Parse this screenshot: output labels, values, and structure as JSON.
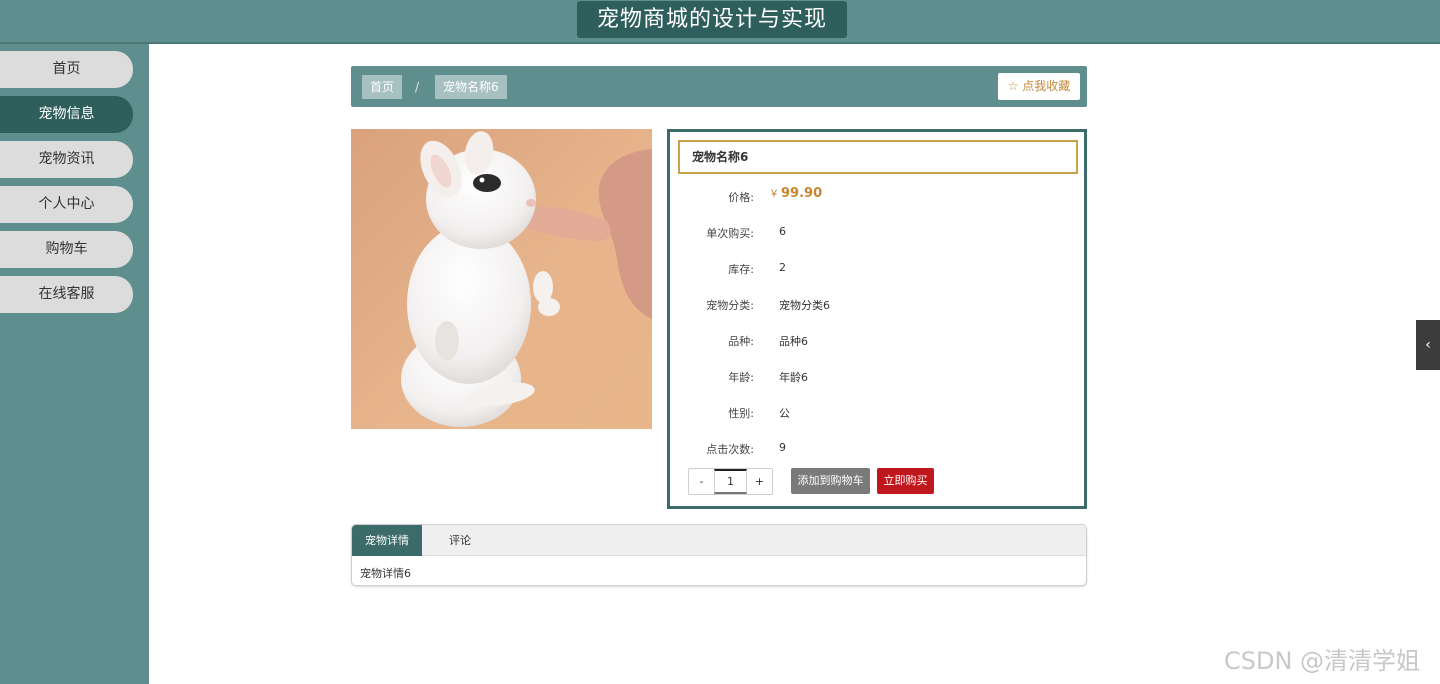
{
  "header": {
    "title": "宠物商城的设计与实现"
  },
  "sidebar": {
    "items": [
      {
        "label": "首页",
        "active": false
      },
      {
        "label": "宠物信息",
        "active": true
      },
      {
        "label": "宠物资讯",
        "active": false
      },
      {
        "label": "个人中心",
        "active": false
      },
      {
        "label": "购物车",
        "active": false
      },
      {
        "label": "在线客服",
        "active": false
      }
    ]
  },
  "breadcrumb": {
    "home": "首页",
    "separator": "/",
    "current": "宠物名称6",
    "favorite_icon": "star-outline-icon",
    "favorite_label": "☆ 点我收藏"
  },
  "product": {
    "image_alt": "white rabbit",
    "name": "宠物名称6",
    "price_symbol": "￥",
    "price": "99.90",
    "rows": [
      {
        "label": "价格:"
      },
      {
        "label": "单次购买:",
        "value": "6"
      },
      {
        "label": "库存:",
        "value": "2"
      },
      {
        "label": "宠物分类:",
        "value": "宠物分类6"
      },
      {
        "label": "品种:",
        "value": "品种6"
      },
      {
        "label": "年龄:",
        "value": "年龄6"
      },
      {
        "label": "性别:",
        "value": "公"
      },
      {
        "label": "点击次数:",
        "value": "9"
      }
    ],
    "quantity": {
      "minus": "-",
      "value": "1",
      "plus": "+"
    },
    "add_to_cart": "添加到购物车",
    "buy_now": "立即购买"
  },
  "tabs": {
    "items": [
      {
        "label": "宠物详情",
        "active": true
      },
      {
        "label": "评论",
        "active": false
      }
    ],
    "content": "宠物详情6"
  },
  "side_toggle": {
    "icon": "chevron-left-icon",
    "glyph": "‹"
  },
  "watermark": "CSDN @清清学姐",
  "colors": {
    "teal": "#5e8f8e",
    "teal_dark": "#2f5f5c",
    "price": "#c9852d",
    "buy": "#c0161d",
    "cart": "#7a7a7a",
    "gold_border": "#c9a14a"
  }
}
